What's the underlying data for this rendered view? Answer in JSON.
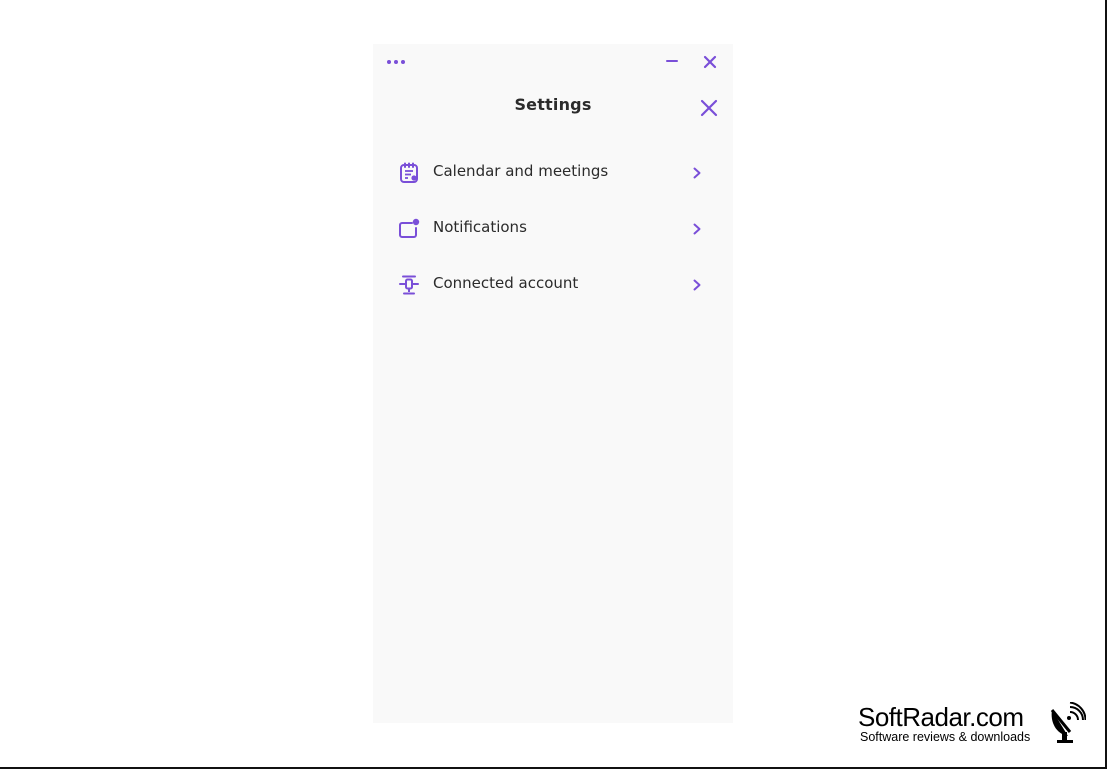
{
  "window": {
    "more_icon": "more-horizontal-icon",
    "minimize_icon": "minimize-icon",
    "close_icon": "close-icon"
  },
  "settings": {
    "title": "Settings",
    "close_icon": "close-icon",
    "items": [
      {
        "label": "Calendar and meetings",
        "icon": "calendar-notes-icon",
        "chevron": "chevron-right-icon"
      },
      {
        "label": "Notifications",
        "icon": "notification-badge-icon",
        "chevron": "chevron-right-icon"
      },
      {
        "label": "Connected account",
        "icon": "connected-device-icon",
        "chevron": "chevron-right-icon"
      }
    ]
  },
  "watermark": {
    "brand": "SoftRadar.com",
    "tagline": "Software reviews & downloads"
  },
  "colors": {
    "accent": "#7a4fd8",
    "panel_background": "#f9f9f9",
    "text": "#2b2b2b"
  }
}
